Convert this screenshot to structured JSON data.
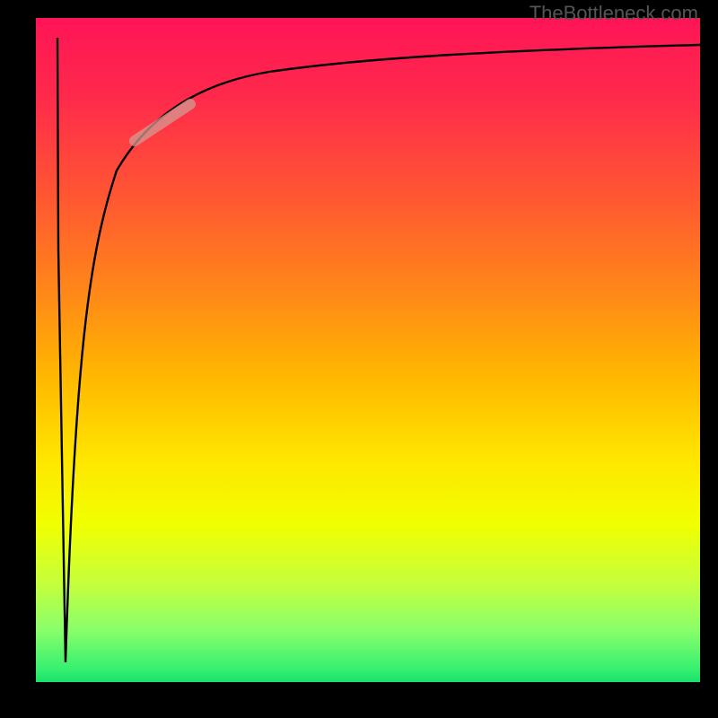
{
  "watermark": "TheBottleneck.com",
  "chart_data": {
    "type": "line",
    "title": "",
    "xlabel": "",
    "ylabel": "",
    "xlim": [
      0,
      100
    ],
    "ylim": [
      0,
      100
    ],
    "grid": false,
    "legend": false,
    "background_gradient": {
      "direction": "vertical",
      "stops": [
        {
          "pos": 0.0,
          "color": "#ff1457"
        },
        {
          "pos": 0.28,
          "color": "#ff5a30"
        },
        {
          "pos": 0.54,
          "color": "#ffb700"
        },
        {
          "pos": 0.76,
          "color": "#f2ff00"
        },
        {
          "pos": 0.92,
          "color": "#8bff6a"
        },
        {
          "pos": 1.0,
          "color": "#19e26a"
        }
      ]
    },
    "series": [
      {
        "name": "curve-left",
        "color": "#000000",
        "x": [
          3.3,
          3.5,
          4.0,
          4.4
        ],
        "y": [
          97,
          65,
          30,
          3
        ]
      },
      {
        "name": "curve-right",
        "color": "#000000",
        "x": [
          4.4,
          6,
          8,
          12,
          18,
          25,
          35,
          50,
          70,
          100
        ],
        "y": [
          3,
          50,
          65,
          77,
          84,
          88,
          91,
          93.5,
          95,
          96
        ]
      }
    ],
    "annotations": [
      {
        "name": "highlight-segment",
        "type": "segment_overlay",
        "color": "#d49a92",
        "opacity": 0.75,
        "width": 12,
        "x": [
          15,
          23
        ],
        "y": [
          81.5,
          87
        ]
      }
    ]
  }
}
